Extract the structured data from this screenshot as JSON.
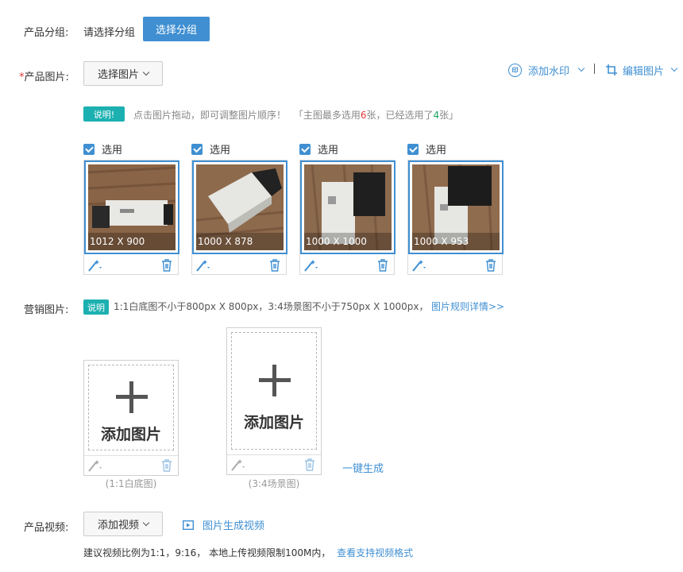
{
  "product_group": {
    "label": "产品分组:",
    "placeholder_text": "请选择分组",
    "button": "选择分组"
  },
  "product_images": {
    "required_mark": "*",
    "label": "产品图片:",
    "select_button": "选择图片",
    "watermark_button": "添加水印",
    "edit_button": "编辑图片",
    "note_tag": "说明!",
    "note_text": "点击图片拖动，即可调整图片顺序！",
    "note_bracket_open": "「主图最多选用",
    "note_max": "6",
    "note_mid": "张，已经选用了",
    "note_count": "4",
    "note_end": "张」",
    "select_label": "选用",
    "items": [
      {
        "size": "1012 X 900"
      },
      {
        "size": "1000 X 878"
      },
      {
        "size": "1000 X 1000"
      },
      {
        "size": "1000 X 953"
      }
    ]
  },
  "marketing_images": {
    "label": "营销图片:",
    "note_tag": "说明",
    "note_text": "1:1白底图不小于800px X 800px，3:4场景图不小于750px X 1000px，",
    "rules_link": "图片规则详情>>",
    "add_text": "添加图片",
    "caption_square": "(1:1白底图)",
    "caption_scene": "(3:4场景图)",
    "generate_link": "一键生成"
  },
  "product_video": {
    "label": "产品视频:",
    "add_button": "添加视频",
    "generate_link": "图片生成视频",
    "hint": "建议视频比例为1:1，9:16， 本地上传视频限制100M内，",
    "formats_link": "查看支持视频格式"
  },
  "colors": {
    "accent": "#3f8fd2",
    "tag": "#1cb0b0",
    "danger": "#e4393c"
  }
}
